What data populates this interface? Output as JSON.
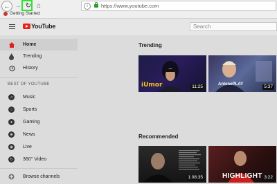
{
  "browser": {
    "url": "https://www.youtube.com",
    "bookmark": "Getting Started",
    "highlight_color": "#2ee52e"
  },
  "youtube": {
    "logo_text": "YouTube",
    "search_placeholder": "Search"
  },
  "sidebar": {
    "items": [
      {
        "label": "Home",
        "icon": "home-icon",
        "active": true
      },
      {
        "label": "Trending",
        "icon": "flame-icon"
      },
      {
        "label": "History",
        "icon": "history-icon"
      }
    ],
    "section_title": "BEST OF YOUTUBE",
    "best_of": [
      {
        "label": "Music",
        "icon": "music-icon"
      },
      {
        "label": "Sports",
        "icon": "sports-icon"
      },
      {
        "label": "Gaming",
        "icon": "gaming-icon"
      },
      {
        "label": "News",
        "icon": "news-icon"
      },
      {
        "label": "Live",
        "icon": "live-icon"
      },
      {
        "label": "360° Video",
        "icon": "360-video-icon"
      }
    ],
    "browse_channels": "Browse channels"
  },
  "main": {
    "trending_title": "Trending",
    "recommended_title": "Recommended",
    "trending_videos": [
      {
        "duration": "11:25",
        "overlay": "iUmor"
      },
      {
        "duration": "5:37",
        "overlay": "AntenoPLAY"
      }
    ],
    "recommended_videos": [
      {
        "duration": "1:08:35"
      },
      {
        "duration": "3:22",
        "overlay": "HIGHLIGHT"
      }
    ]
  }
}
